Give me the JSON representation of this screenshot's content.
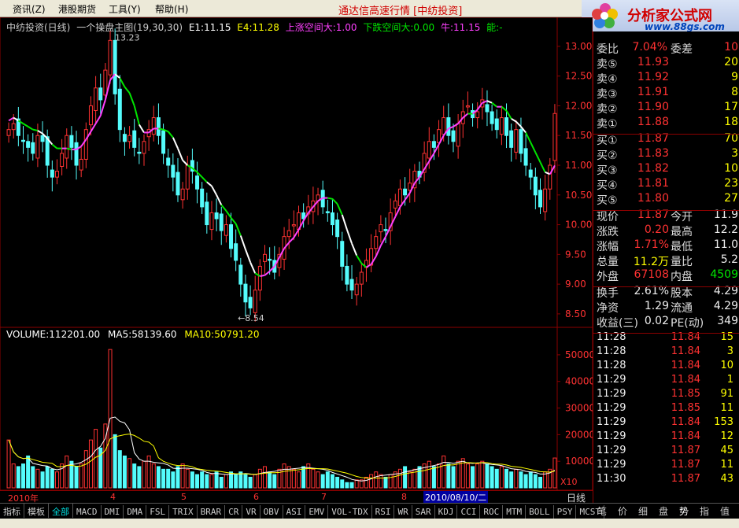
{
  "menu": {
    "items": [
      "资讯(Z)",
      "港股期货",
      "工具(Y)",
      "帮助(H)"
    ],
    "title": "通达信高速行情 [中纺投资]"
  },
  "logo": {
    "text": "分析家公式网",
    "url": "www.88gs.com"
  },
  "chart_header": {
    "name": "中纺投资(日线)",
    "indicator": "一个操盘主图(19,30,30)",
    "e1": "E1:11.15",
    "e4": "E4:11.28",
    "up_space": "上涨空间大:1.00",
    "down_space": "下跌空间大:0.00",
    "bull": "牛:11.15",
    "energy": "能:-"
  },
  "annotations": {
    "high": "13.23",
    "low": "8.54"
  },
  "volume_header": {
    "volume": "VOLUME:112201.00",
    "ma5": "MA5:58139.60",
    "ma10": "MA10:50791.20"
  },
  "x10_label": "X10",
  "date_bar": {
    "start": "2010年",
    "m4": "4",
    "m5": "5",
    "m6": "6",
    "m7": "7",
    "m8": "8",
    "cursor_date": "2010/08/10/二",
    "period": "日线"
  },
  "tabs": [
    "指标",
    "模板",
    "全部",
    "MACD",
    "DMI",
    "DMA",
    "FSL",
    "TRIX",
    "BRAR",
    "CR",
    "VR",
    "OBV",
    "ASI",
    "EMV",
    "VOL-TDX",
    "RSI",
    "WR",
    "SAR",
    "KDJ",
    "CCI",
    "ROC",
    "MTM",
    "BOLL",
    "PSY",
    "MCST"
  ],
  "side_tabs": [
    "笔",
    "价",
    "细",
    "盘",
    "势",
    "指",
    "值"
  ],
  "quote": {
    "weibi_label": "委比",
    "weibi": "7.04%",
    "weicha_label": "委差",
    "weicha": "10",
    "sells": [
      {
        "label": "卖⑤",
        "price": "11.93",
        "vol": "20"
      },
      {
        "label": "卖④",
        "price": "11.92",
        "vol": "9"
      },
      {
        "label": "卖③",
        "price": "11.91",
        "vol": "8"
      },
      {
        "label": "卖②",
        "price": "11.90",
        "vol": "17"
      },
      {
        "label": "卖①",
        "price": "11.88",
        "vol": "18"
      }
    ],
    "buys": [
      {
        "label": "买①",
        "price": "11.87",
        "vol": "70"
      },
      {
        "label": "买②",
        "price": "11.83",
        "vol": "3"
      },
      {
        "label": "买③",
        "price": "11.82",
        "vol": "10"
      },
      {
        "label": "买④",
        "price": "11.81",
        "vol": "23"
      },
      {
        "label": "买⑤",
        "price": "11.80",
        "vol": "27"
      }
    ],
    "stats": [
      {
        "l1": "现价",
        "v1": "11.87",
        "l2": "今开",
        "v2": "11.9"
      },
      {
        "l1": "涨跌",
        "v1": "0.20",
        "l2": "最高",
        "v2": "12.2"
      },
      {
        "l1": "涨幅",
        "v1": "1.71%",
        "l2": "最低",
        "v2": "11.0"
      },
      {
        "l1": "总量",
        "v1": "11.2万",
        "l2": "量比",
        "v2": "5.2"
      },
      {
        "l1": "外盘",
        "v1": "67108",
        "l2": "内盘",
        "v2": "4509"
      }
    ],
    "stats2": [
      {
        "l1": "换手",
        "v1": "2.61%",
        "l2": "股本",
        "v2": "4.29"
      },
      {
        "l1": "净资",
        "v1": "1.29",
        "l2": "流通",
        "v2": "4.29"
      },
      {
        "l1": "收益(三)",
        "v1": "0.02",
        "l2": "PE(动)",
        "v2": "349"
      }
    ],
    "ticks": [
      {
        "time": "11:28",
        "price": "11.84",
        "vol": "15"
      },
      {
        "time": "11:28",
        "price": "11.84",
        "vol": "3"
      },
      {
        "time": "11:28",
        "price": "11.84",
        "vol": "10"
      },
      {
        "time": "11:29",
        "price": "11.84",
        "vol": "1"
      },
      {
        "time": "11:29",
        "price": "11.85",
        "vol": "91"
      },
      {
        "time": "11:29",
        "price": "11.85",
        "vol": "11"
      },
      {
        "time": "11:29",
        "price": "11.84",
        "vol": "153"
      },
      {
        "time": "11:29",
        "price": "11.84",
        "vol": "12"
      },
      {
        "time": "11:29",
        "price": "11.87",
        "vol": "45"
      },
      {
        "time": "11:29",
        "price": "11.87",
        "vol": "11"
      },
      {
        "time": "11:30",
        "price": "11.87",
        "vol": "43"
      }
    ]
  },
  "price_axis": [
    "13.00",
    "12.50",
    "12.00",
    "11.50",
    "11.00",
    "10.50",
    "10.00",
    "9.50",
    "9.00",
    "8.50"
  ],
  "volume_axis": [
    "50000",
    "40000",
    "30000",
    "20000",
    "10000"
  ],
  "chart_data": {
    "type": "candlestick",
    "price_range": [
      8.3,
      13.25
    ],
    "volume_range": [
      0,
      55000
    ],
    "close": [
      11.6,
      11.7,
      11.5,
      11.4,
      11.3,
      11.2,
      11.5,
      11.4,
      11.0,
      10.8,
      10.9,
      11.2,
      11.5,
      11.3,
      11.0,
      11.1,
      11.6,
      12.0,
      12.3,
      12.1,
      12.6,
      13.1,
      12.2,
      11.6,
      11.4,
      11.5,
      11.3,
      11.2,
      11.4,
      11.6,
      11.8,
      11.5,
      11.2,
      11.0,
      10.8,
      10.5,
      10.6,
      11.0,
      10.9,
      10.6,
      10.3,
      10.0,
      10.2,
      10.1,
      9.9,
      10.0,
      9.6,
      9.4,
      9.0,
      8.7,
      8.6,
      8.9,
      9.3,
      9.5,
      9.4,
      9.2,
      9.5,
      9.8,
      9.9,
      10.0,
      10.2,
      10.1,
      10.3,
      10.4,
      10.5,
      10.3,
      10.2,
      10.0,
      9.8,
      9.3,
      9.0,
      8.9,
      9.0,
      9.2,
      9.4,
      9.6,
      9.8,
      10.0,
      9.9,
      10.2,
      10.4,
      10.6,
      10.5,
      10.7,
      10.9,
      10.8,
      11.2,
      11.4,
      11.3,
      11.6,
      11.8,
      11.5,
      11.4,
      11.7,
      11.9,
      12.0,
      11.8,
      11.9,
      12.1,
      11.9,
      11.7,
      11.6,
      11.8,
      11.5,
      11.3,
      11.6,
      11.2,
      11.0,
      10.8,
      10.5,
      10.3,
      10.6,
      11.0,
      11.87
    ],
    "volume": [
      18000,
      9000,
      8000,
      9000,
      12000,
      8000,
      7000,
      6000,
      8000,
      7000,
      6000,
      9000,
      12000,
      10000,
      8000,
      9000,
      14000,
      18000,
      22000,
      15000,
      24000,
      52000,
      20000,
      14000,
      12000,
      11000,
      9000,
      8000,
      10000,
      12000,
      9000,
      8000,
      7000,
      7000,
      6000,
      8000,
      9000,
      7000,
      6000,
      5000,
      6000,
      5000,
      5000,
      6000,
      4000,
      5000,
      6000,
      5000,
      6000,
      5000,
      4000,
      5000,
      7000,
      8000,
      6000,
      5000,
      7000,
      9000,
      8000,
      7000,
      6000,
      8000,
      9000,
      7000,
      6000,
      5000,
      6000,
      5000,
      4000,
      3000,
      2000,
      2000,
      3000,
      3000,
      4000,
      5000,
      6000,
      5000,
      4000,
      5000,
      6000,
      7000,
      8000,
      6000,
      7000,
      8000,
      9000,
      10000,
      8000,
      9000,
      12000,
      9000,
      8000,
      10000,
      11000,
      9000,
      8000,
      9000,
      10000,
      9000,
      8000,
      7000,
      8000,
      7000,
      6000,
      7000,
      6000,
      5000,
      6000,
      5000,
      4000,
      6000,
      7000,
      11220
    ]
  }
}
